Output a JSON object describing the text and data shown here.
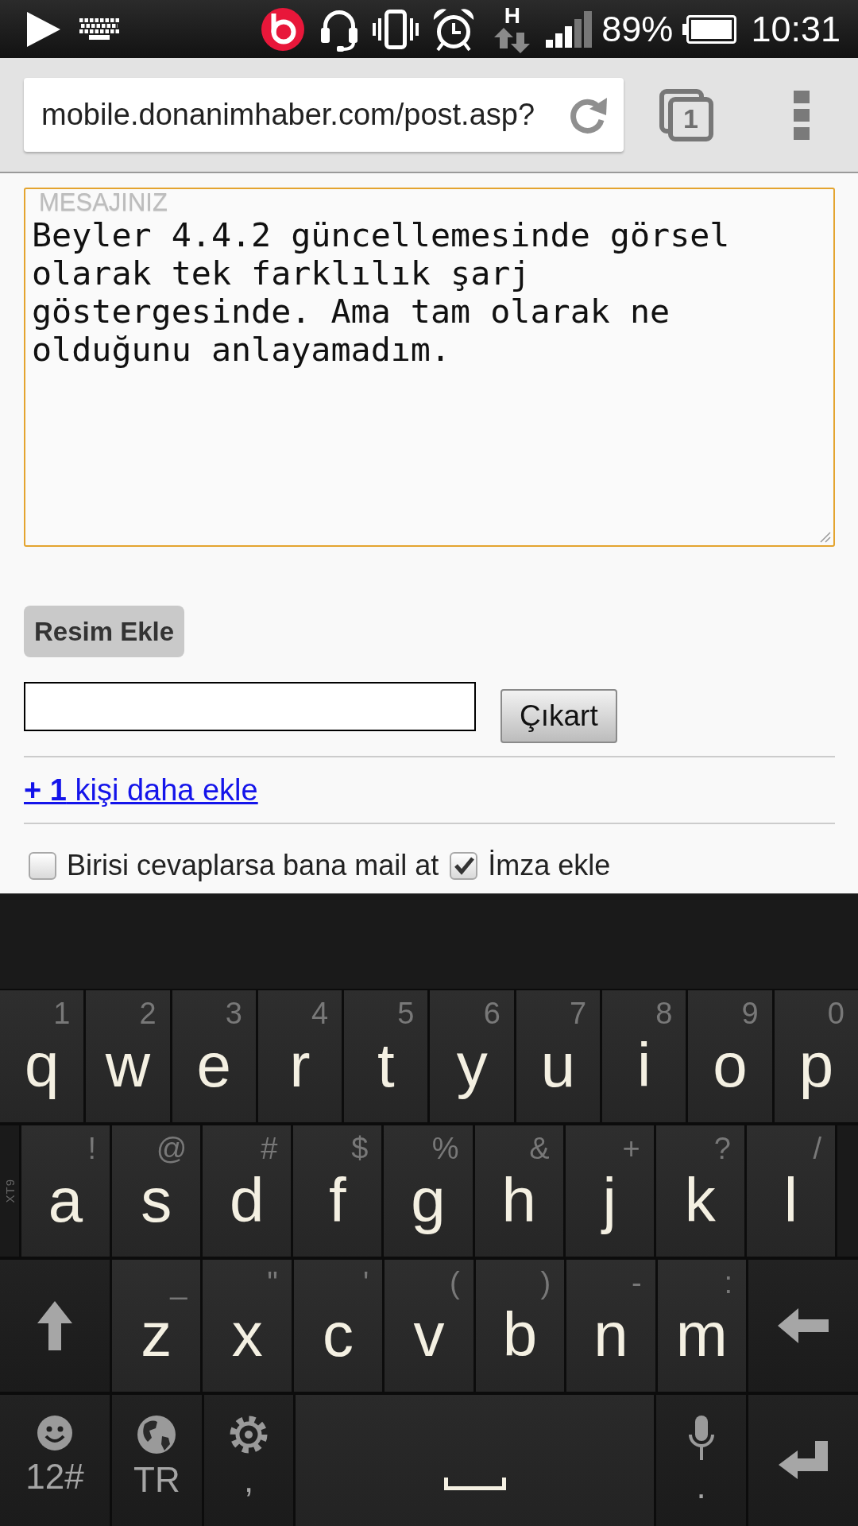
{
  "status_bar": {
    "network_type": "H",
    "battery": "89%",
    "time": "10:31"
  },
  "browser_toolbar": {
    "url": "mobile.donanimhaber.com/post.asp?",
    "tab_count": "1"
  },
  "message_field": {
    "label": "MESAJINIZ",
    "value": "Beyler 4.4.2 güncellemesinde görsel olarak tek farklılık şarj göstergesinde. Ama tam olarak ne olduğunu anlayamadım.",
    "focused": true
  },
  "add_image_button": "Resim Ekle",
  "image_row": {
    "remove_button": "Çıkart"
  },
  "add_person_link": "**+ 1** kişi daha ekle",
  "options": [
    {
      "label": "Birisi cevaplarsa bana mail at",
      "checked": false
    },
    {
      "label": "İmza ekle",
      "checked": true
    }
  ],
  "keyboard": {
    "rows": [
      {
        "keys": [
          {
            "kind": "char",
            "label": "q",
            "hint": "1"
          },
          {
            "kind": "char",
            "label": "w",
            "hint": "2"
          },
          {
            "kind": "char",
            "label": "e",
            "hint": "3"
          },
          {
            "kind": "char",
            "label": "r",
            "hint": "4"
          },
          {
            "kind": "char",
            "label": "t",
            "hint": "5"
          },
          {
            "kind": "char",
            "label": "y",
            "hint": "6"
          },
          {
            "kind": "char",
            "label": "u",
            "hint": "7"
          },
          {
            "kind": "char",
            "label": "i",
            "hint": "8"
          },
          {
            "kind": "char",
            "label": "o",
            "hint": "9"
          },
          {
            "kind": "char",
            "label": "p",
            "hint": "0"
          }
        ]
      },
      {
        "side_label": "XT9",
        "keys": [
          {
            "kind": "char",
            "label": "a",
            "hint": "!"
          },
          {
            "kind": "char",
            "label": "s",
            "hint": "@"
          },
          {
            "kind": "char",
            "label": "d",
            "hint": "#"
          },
          {
            "kind": "char",
            "label": "f",
            "hint": "$"
          },
          {
            "kind": "char",
            "label": "g",
            "hint": "%"
          },
          {
            "kind": "char",
            "label": "h",
            "hint": "&"
          },
          {
            "kind": "char",
            "label": "j",
            "hint": "+"
          },
          {
            "kind": "char",
            "label": "k",
            "hint": "?"
          },
          {
            "kind": "char",
            "label": "l",
            "hint": "/"
          }
        ]
      },
      {
        "keys": [
          {
            "kind": "shift"
          },
          {
            "kind": "char",
            "label": "z",
            "hint": "_"
          },
          {
            "kind": "char",
            "label": "x",
            "hint": "\""
          },
          {
            "kind": "char",
            "label": "c",
            "hint": "'"
          },
          {
            "kind": "char",
            "label": "v",
            "hint": "("
          },
          {
            "kind": "char",
            "label": "b",
            "hint": ")"
          },
          {
            "kind": "char",
            "label": "n",
            "hint": "-"
          },
          {
            "kind": "char",
            "label": "m",
            "hint": ":"
          },
          {
            "kind": "backspace"
          }
        ]
      },
      {
        "keys": [
          {
            "kind": "emoji",
            "label": "12#"
          },
          {
            "kind": "language",
            "label": "TR"
          },
          {
            "kind": "settings",
            "label": ","
          },
          {
            "kind": "space"
          },
          {
            "kind": "voice",
            "label": "."
          },
          {
            "kind": "enter"
          }
        ]
      }
    ]
  }
}
